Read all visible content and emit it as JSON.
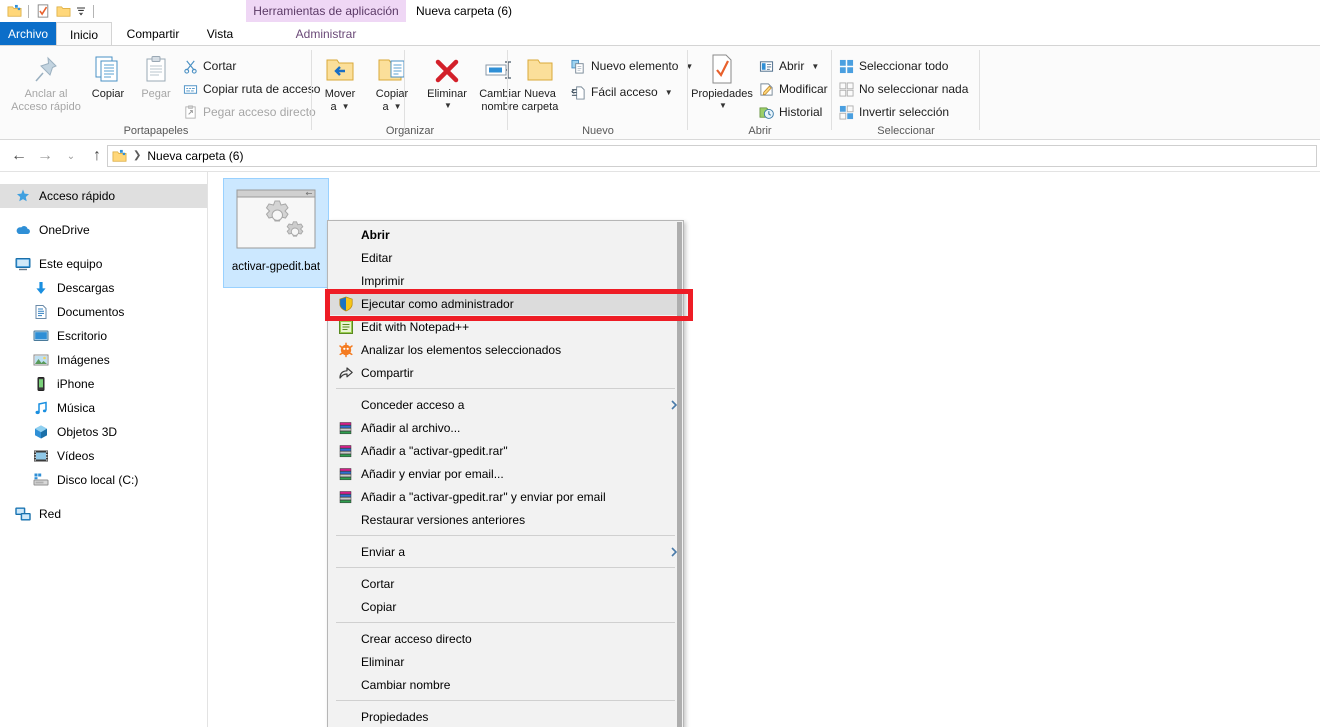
{
  "window": {
    "title": "Nueva carpeta (6)",
    "contextual_tab_group": "Herramientas de aplicación",
    "quick_access": [
      {
        "name": "folder-properties-icon",
        "label": "Propiedades"
      },
      {
        "name": "new-folder-icon",
        "label": "Nueva carpeta"
      },
      {
        "name": "customize-qat-icon",
        "label": "Personalizar barra de herramientas de acceso rápido"
      }
    ]
  },
  "tabs": [
    {
      "id": "file",
      "label": "Archivo",
      "state": "file"
    },
    {
      "id": "home",
      "label": "Inicio",
      "state": "active"
    },
    {
      "id": "share",
      "label": "Compartir",
      "state": "normal"
    },
    {
      "id": "view",
      "label": "Vista",
      "state": "normal"
    },
    {
      "id": "manage",
      "label": "Administrar",
      "state": "contextual"
    }
  ],
  "ribbon": {
    "groups": [
      {
        "id": "clipboard",
        "label": "Portapapeles",
        "big_buttons": [
          {
            "label_line1": "Anclar al",
            "label_line2": "Acceso rápido",
            "icon": "pin-icon",
            "enabled": false
          },
          {
            "label_line1": "Copiar",
            "label_line2": "",
            "icon": "copy-icon",
            "enabled": true
          },
          {
            "label_line1": "Pegar",
            "label_line2": "",
            "icon": "paste-icon",
            "enabled": false
          }
        ],
        "small_buttons": [
          {
            "label": "Cortar",
            "icon": "scissors-icon",
            "enabled": true
          },
          {
            "label": "Copiar ruta de acceso",
            "icon": "copy-path-icon",
            "enabled": true
          },
          {
            "label": "Pegar acceso directo",
            "icon": "paste-shortcut-icon",
            "enabled": false
          }
        ]
      },
      {
        "id": "organize",
        "label": "Organizar",
        "big_buttons": [
          {
            "label_line1": "Mover",
            "label_line2": "a",
            "icon": "move-to-icon",
            "enabled": true,
            "dropdown": true
          },
          {
            "label_line1": "Copiar",
            "label_line2": "a",
            "icon": "copy-to-icon",
            "enabled": true,
            "dropdown": true
          },
          {
            "label_line1": "Eliminar",
            "label_line2": "",
            "icon": "delete-icon",
            "enabled": true,
            "dropdown": true
          },
          {
            "label_line1": "Cambiar",
            "label_line2": "nombre",
            "icon": "rename-icon",
            "enabled": true
          }
        ],
        "small_buttons": []
      },
      {
        "id": "new",
        "label": "Nuevo",
        "big_buttons": [
          {
            "label_line1": "Nueva",
            "label_line2": "carpeta",
            "icon": "new-folder-icon",
            "enabled": true
          }
        ],
        "small_buttons": [
          {
            "label": "Nuevo elemento",
            "icon": "new-item-icon",
            "enabled": true,
            "dropdown": true
          },
          {
            "label": "Fácil acceso",
            "icon": "easy-access-icon",
            "enabled": true,
            "dropdown": true
          }
        ]
      },
      {
        "id": "open",
        "label": "Abrir",
        "big_buttons": [
          {
            "label_line1": "Propiedades",
            "label_line2": "",
            "icon": "properties-icon",
            "enabled": true,
            "dropdown": true
          }
        ],
        "small_buttons": [
          {
            "label": "Abrir",
            "icon": "open-icon",
            "enabled": true,
            "dropdown": true
          },
          {
            "label": "Modificar",
            "icon": "edit-icon",
            "enabled": true
          },
          {
            "label": "Historial",
            "icon": "history-icon",
            "enabled": true
          }
        ]
      },
      {
        "id": "select",
        "label": "Seleccionar",
        "big_buttons": [],
        "small_buttons": [
          {
            "label": "Seleccionar todo",
            "icon": "select-all-icon",
            "enabled": true
          },
          {
            "label": "No seleccionar nada",
            "icon": "select-none-icon",
            "enabled": true
          },
          {
            "label": "Invertir selección",
            "icon": "invert-selection-icon",
            "enabled": true
          }
        ]
      }
    ]
  },
  "address_bar": {
    "back_label": "Atrás",
    "forward_label": "Adelante",
    "recent_label": "Ubicaciones recientes",
    "up_label": "Subir un nivel",
    "path_crumbs": [
      "Nueva carpeta (6)"
    ]
  },
  "sidebar": {
    "items": [
      {
        "label": "Acceso rápido",
        "icon": "star-pin-icon",
        "level": 0,
        "selected": true,
        "gap_after": true
      },
      {
        "label": "OneDrive",
        "icon": "onedrive-cloud-icon",
        "level": 0,
        "selected": false,
        "gap_after": true
      },
      {
        "label": "Este equipo",
        "icon": "computer-icon",
        "level": 0,
        "selected": false,
        "gap_after": false
      },
      {
        "label": "Descargas",
        "icon": "downloads-arrow-icon",
        "level": 1,
        "selected": false,
        "gap_after": false
      },
      {
        "label": "Documentos",
        "icon": "documents-icon",
        "level": 1,
        "selected": false,
        "gap_after": false
      },
      {
        "label": "Escritorio",
        "icon": "desktop-icon",
        "level": 1,
        "selected": false,
        "gap_after": false
      },
      {
        "label": "Imágenes",
        "icon": "pictures-icon",
        "level": 1,
        "selected": false,
        "gap_after": false
      },
      {
        "label": "iPhone",
        "icon": "phone-icon",
        "level": 1,
        "selected": false,
        "gap_after": false
      },
      {
        "label": "Música",
        "icon": "music-note-icon",
        "level": 1,
        "selected": false,
        "gap_after": false
      },
      {
        "label": "Objetos 3D",
        "icon": "3d-objects-icon",
        "level": 1,
        "selected": false,
        "gap_after": false
      },
      {
        "label": "Vídeos",
        "icon": "videos-icon",
        "level": 1,
        "selected": false,
        "gap_after": false
      },
      {
        "label": "Disco local (C:)",
        "icon": "hard-drive-icon",
        "level": 1,
        "selected": false,
        "gap_after": true
      },
      {
        "label": "Red",
        "icon": "network-icon",
        "level": 0,
        "selected": false,
        "gap_after": false
      }
    ]
  },
  "files": [
    {
      "name": "activar-gpedit.bat",
      "icon": "bat-script-gears-icon",
      "selected": true
    }
  ],
  "context_menu": {
    "items": [
      {
        "type": "item",
        "label": "Abrir",
        "icon": "",
        "bold": true,
        "highlighted": false,
        "submenu": false
      },
      {
        "type": "item",
        "label": "Editar",
        "icon": "",
        "bold": false,
        "highlighted": false,
        "submenu": false
      },
      {
        "type": "item",
        "label": "Imprimir",
        "icon": "",
        "bold": false,
        "highlighted": false,
        "submenu": false
      },
      {
        "type": "item",
        "label": "Ejecutar como administrador",
        "icon": "uac-shield-icon",
        "bold": false,
        "highlighted": true,
        "submenu": false
      },
      {
        "type": "item",
        "label": "Edit with Notepad++",
        "icon": "notepadpp-icon",
        "bold": false,
        "highlighted": false,
        "submenu": false
      },
      {
        "type": "item",
        "label": "Analizar los elementos seleccionados",
        "icon": "avast-icon",
        "bold": false,
        "highlighted": false,
        "submenu": false
      },
      {
        "type": "item",
        "label": "Compartir",
        "icon": "share-arrow-icon",
        "bold": false,
        "highlighted": false,
        "submenu": false
      },
      {
        "type": "separator"
      },
      {
        "type": "item",
        "label": "Conceder acceso a",
        "icon": "",
        "bold": false,
        "highlighted": false,
        "submenu": true
      },
      {
        "type": "item",
        "label": "Añadir al archivo...",
        "icon": "winrar-icon",
        "bold": false,
        "highlighted": false,
        "submenu": false
      },
      {
        "type": "item",
        "label": "Añadir a \"activar-gpedit.rar\"",
        "icon": "winrar-icon",
        "bold": false,
        "highlighted": false,
        "submenu": false
      },
      {
        "type": "item",
        "label": "Añadir y enviar por email...",
        "icon": "winrar-icon",
        "bold": false,
        "highlighted": false,
        "submenu": false
      },
      {
        "type": "item",
        "label": "Añadir a \"activar-gpedit.rar\" y enviar por email",
        "icon": "winrar-icon",
        "bold": false,
        "highlighted": false,
        "submenu": false
      },
      {
        "type": "item",
        "label": "Restaurar versiones anteriores",
        "icon": "",
        "bold": false,
        "highlighted": false,
        "submenu": false
      },
      {
        "type": "separator"
      },
      {
        "type": "item",
        "label": "Enviar a",
        "icon": "",
        "bold": false,
        "highlighted": false,
        "submenu": true
      },
      {
        "type": "separator"
      },
      {
        "type": "item",
        "label": "Cortar",
        "icon": "",
        "bold": false,
        "highlighted": false,
        "submenu": false
      },
      {
        "type": "item",
        "label": "Copiar",
        "icon": "",
        "bold": false,
        "highlighted": false,
        "submenu": false
      },
      {
        "type": "separator"
      },
      {
        "type": "item",
        "label": "Crear acceso directo",
        "icon": "",
        "bold": false,
        "highlighted": false,
        "submenu": false
      },
      {
        "type": "item",
        "label": "Eliminar",
        "icon": "",
        "bold": false,
        "highlighted": false,
        "submenu": false
      },
      {
        "type": "item",
        "label": "Cambiar nombre",
        "icon": "",
        "bold": false,
        "highlighted": false,
        "submenu": false
      },
      {
        "type": "separator"
      },
      {
        "type": "item",
        "label": "Propiedades",
        "icon": "",
        "bold": false,
        "highlighted": false,
        "submenu": false
      }
    ]
  },
  "annotation": {
    "type": "red-rectangle-highlight",
    "targets": "Ejecutar como administrador",
    "color": "#ee1c25"
  },
  "colors": {
    "file_tab_blue": "#0b6ec9",
    "contextual_purple": "#efd7f5",
    "selection_blue": "#cce8ff",
    "sidebar_selected_gray": "#dfdfdf",
    "menu_background": "#f2f2f2",
    "annotation_red": "#ee1c25"
  }
}
